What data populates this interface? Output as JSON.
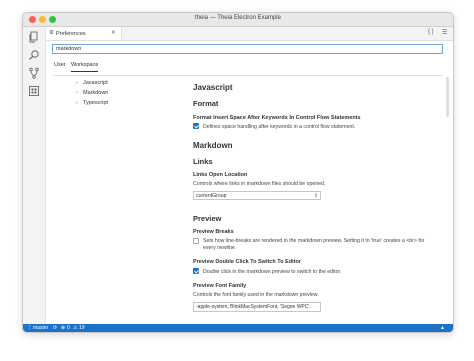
{
  "window": {
    "title": "theia — Theia Electron Example"
  },
  "tab": {
    "label": "Preferences",
    "close": "✕"
  },
  "tab_icons": {
    "left": "{ }",
    "right": "☰"
  },
  "search": {
    "value": "markdown"
  },
  "scopes": {
    "user": "User",
    "workspace": "Workspace"
  },
  "tree": [
    {
      "label": "Javascript"
    },
    {
      "label": "Markdown"
    },
    {
      "label": "Typescript"
    }
  ],
  "editor": {
    "javascript_heading": "Javascript",
    "format_heading": "Format",
    "format_pref_title": "Format Insert Space After Keywords In Control Flow Statements",
    "format_pref_desc": "Defines space handling after keywords in a control flow statement.",
    "markdown_heading": "Markdown",
    "links_heading": "Links",
    "links_pref_title": "Links Open Location",
    "links_pref_desc": "Controls where links in markdown files should be opened.",
    "links_select_value": "currentGroup",
    "preview_heading": "Preview",
    "breaks_title": "Preview Breaks",
    "breaks_desc_1": "Sets how line-breaks are rendered in the markdown preview. Setting it to 'true' creates a <br> for",
    "breaks_desc_2": "every newline.",
    "dblclick_title": "Preview Double Click To Switch To Editor",
    "dblclick_desc": "Double click in the markdown preview to switch to the editor.",
    "font_title": "Preview Font Family",
    "font_desc": "Controls the font family used in the markdown preview.",
    "font_value": "-apple-system, BlinkMacSystemFont, 'Segoe WPC',"
  },
  "statusbar": {
    "branch": "master",
    "sync": "⟳",
    "errors": "0",
    "warnings": "19",
    "bell": "🔔"
  },
  "colors": {
    "accent": "#1a73c9",
    "search_border": "#6fa8dc"
  }
}
